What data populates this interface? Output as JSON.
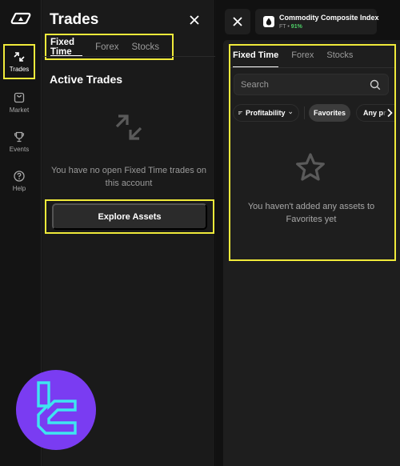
{
  "rail": {
    "logo": "broker-logo-icon",
    "items": [
      {
        "label": "Trades",
        "icon": "trades-arrows-icon",
        "active": true
      },
      {
        "label": "Market",
        "icon": "market-bag-icon",
        "active": false
      },
      {
        "label": "Events",
        "icon": "trophy-icon",
        "active": false
      },
      {
        "label": "Help",
        "icon": "help-question-icon",
        "active": false
      }
    ]
  },
  "trades_panel": {
    "title": "Trades",
    "close_icon": "close-icon",
    "tabs": [
      {
        "label": "Fixed Time",
        "active": true
      },
      {
        "label": "Forex",
        "active": false
      },
      {
        "label": "Stocks",
        "active": false
      }
    ],
    "section_title": "Active Trades",
    "empty_icon": "trades-arrows-icon",
    "empty_text": "You have no open Fixed Time trades on this account",
    "explore_button": "Explore Assets"
  },
  "asset_chip": {
    "name": "Commodity Composite Index",
    "type": "FT",
    "separator": "•",
    "profitability": "91%",
    "icon": "drop-icon"
  },
  "picker": {
    "tabs": [
      {
        "label": "Fixed Time",
        "active": true
      },
      {
        "label": "Forex",
        "active": false
      },
      {
        "label": "Stocks",
        "active": false
      }
    ],
    "search": {
      "placeholder": "Search",
      "value": ""
    },
    "filters": {
      "sort_label": "Profitability",
      "favorites_label": "Favorites",
      "any_label_visible": "Any p",
      "any_label_faded": "r"
    },
    "empty_icon": "star-outline-icon",
    "empty_text": "You haven't added any assets to Favorites yet"
  },
  "colors": {
    "highlight": "#f0ea3a",
    "profit_green": "#4fd168",
    "candle_red": "#e0606c",
    "brand_purple": "#7a3cf2",
    "brand_cyan": "#3ee6f0"
  }
}
